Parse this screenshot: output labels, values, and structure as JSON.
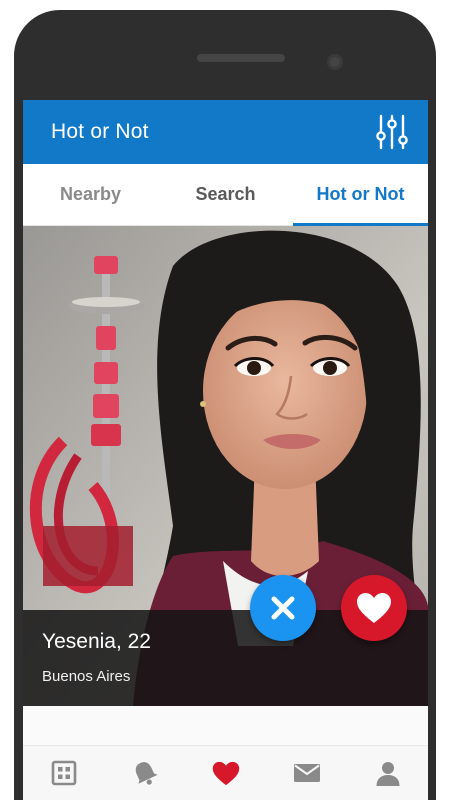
{
  "app_bar": {
    "title": "Hot or Not",
    "filter_icon": "sliders-icon"
  },
  "tabs": [
    {
      "label": "Nearby",
      "active": false
    },
    {
      "label": "Search",
      "active": false
    },
    {
      "label": "Hot or Not",
      "active": true
    }
  ],
  "profile": {
    "name_age": "Yesenia, 22",
    "city": "Buenos Aires"
  },
  "actions": {
    "dislike_icon": "close-icon",
    "like_icon": "heart-icon"
  },
  "bottom_nav": [
    {
      "icon": "grid-icon",
      "active": false
    },
    {
      "icon": "bell-icon",
      "active": false
    },
    {
      "icon": "heart-icon",
      "active": true
    },
    {
      "icon": "mail-icon",
      "active": false
    },
    {
      "icon": "profile-icon",
      "active": false
    }
  ],
  "colors": {
    "primary": "#1279c9",
    "like": "#d7182a",
    "dislike": "#1b93f0",
    "nav_inactive": "#8a8a8a"
  }
}
